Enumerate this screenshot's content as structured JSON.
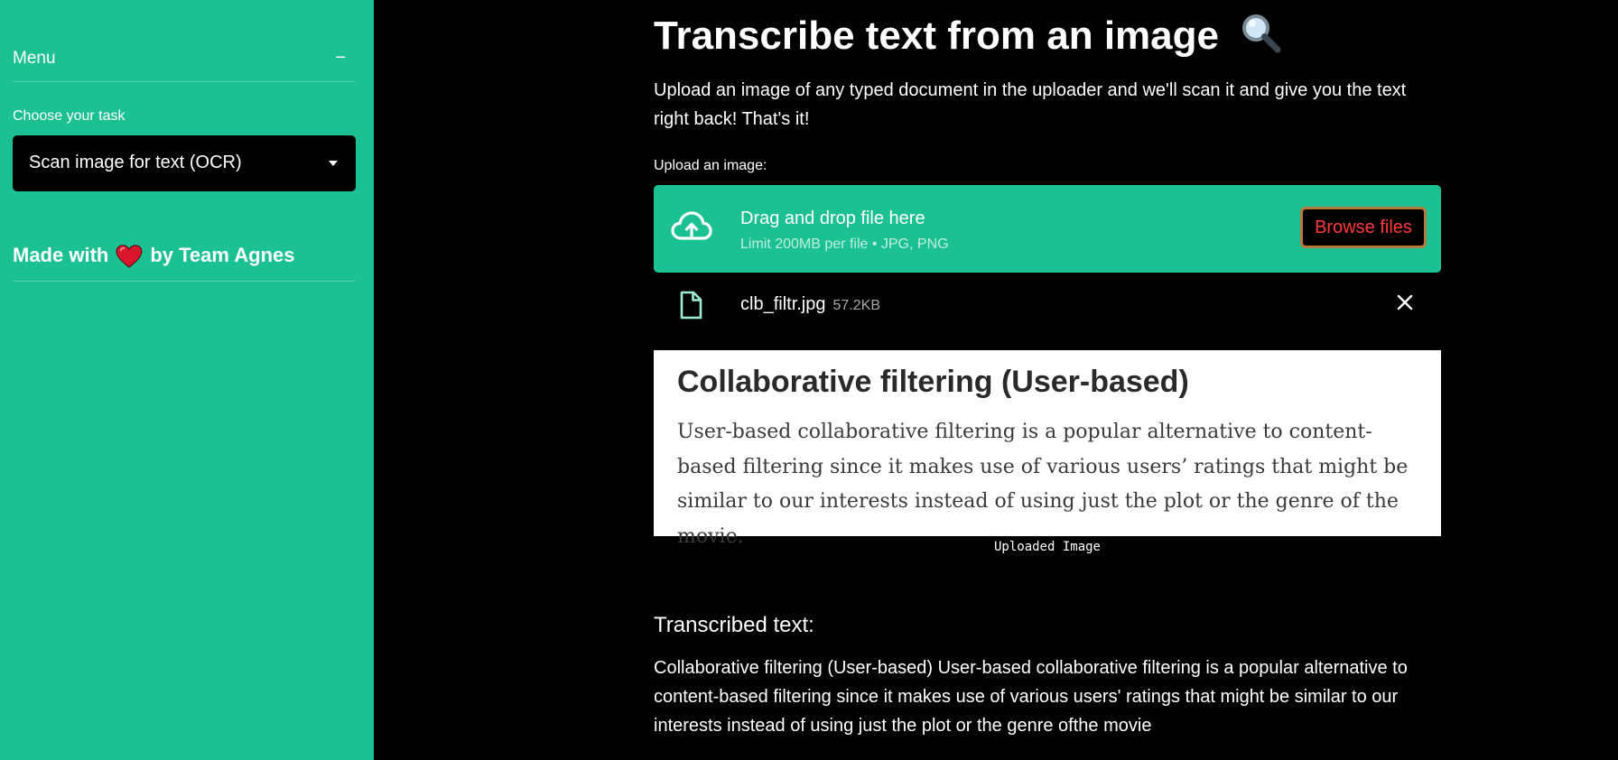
{
  "sidebar": {
    "menu_title": "Menu",
    "collapse_symbol": "−",
    "task_label": "Choose your task",
    "task_selected": "Scan image for text (OCR)",
    "made_with_prefix": "Made with",
    "made_with_suffix": "by Team Agnes",
    "heart_icon": "heart-icon",
    "background": "#1bc190"
  },
  "main": {
    "title": "Transcribe text from an image",
    "title_icon": "magnifying-glass-icon",
    "intro": "Upload an image of any typed document in the uploader and we'll scan it and give you the text right back! That's it!",
    "upload_label": "Upload an image:",
    "dropzone": {
      "title": "Drag and drop file here",
      "subtitle": "Limit 200MB per file • JPG, PNG",
      "browse_label": "Browse files",
      "icon": "cloud-upload-icon"
    },
    "file": {
      "name": "clb_filtr.jpg",
      "size": "57.2KB",
      "icon": "file-icon"
    },
    "preview": {
      "heading": "Collaborative filtering (User-based)",
      "body": "User-based collaborative filtering is a popular alternative to content-based filtering since it makes use of various users’ ratings that might be similar to our interests instead of using just the plot or the genre of the movie.",
      "caption": "Uploaded Image"
    },
    "result": {
      "heading": "Transcribed text:",
      "text": "Collaborative filtering (User-based) User-based collaborative filtering is a popular alternative to content-based filtering since it makes use of various users' ratings that might be similar to our interests instead of using just the plot or the genre ofthe movie"
    }
  },
  "colors": {
    "accent": "#1bc190",
    "background": "#000000",
    "browse_text": "#ff3a3a",
    "browse_border": "#b5793b"
  }
}
